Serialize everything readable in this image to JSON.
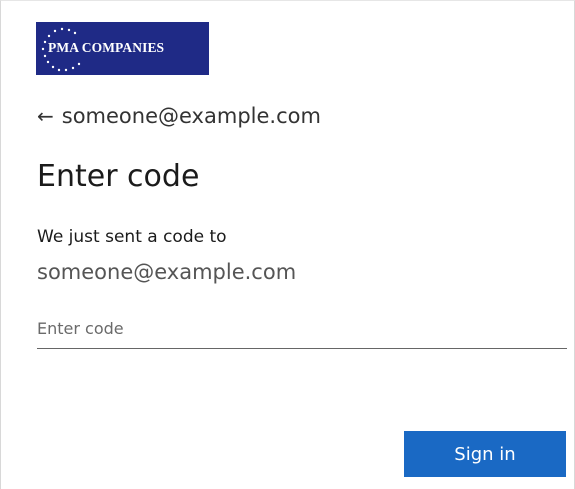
{
  "logo": {
    "text": "PMA COMPANIES",
    "background_color": "#1f2a86"
  },
  "back": {
    "icon": "arrow-left-icon",
    "email": "someone@example.com"
  },
  "heading": "Enter code",
  "description": {
    "line1": "We just sent a code to",
    "line2": "someone@example.com"
  },
  "code_input": {
    "placeholder": "Enter code",
    "value": ""
  },
  "signin_button": {
    "label": "Sign in",
    "color": "#1a69c4"
  }
}
